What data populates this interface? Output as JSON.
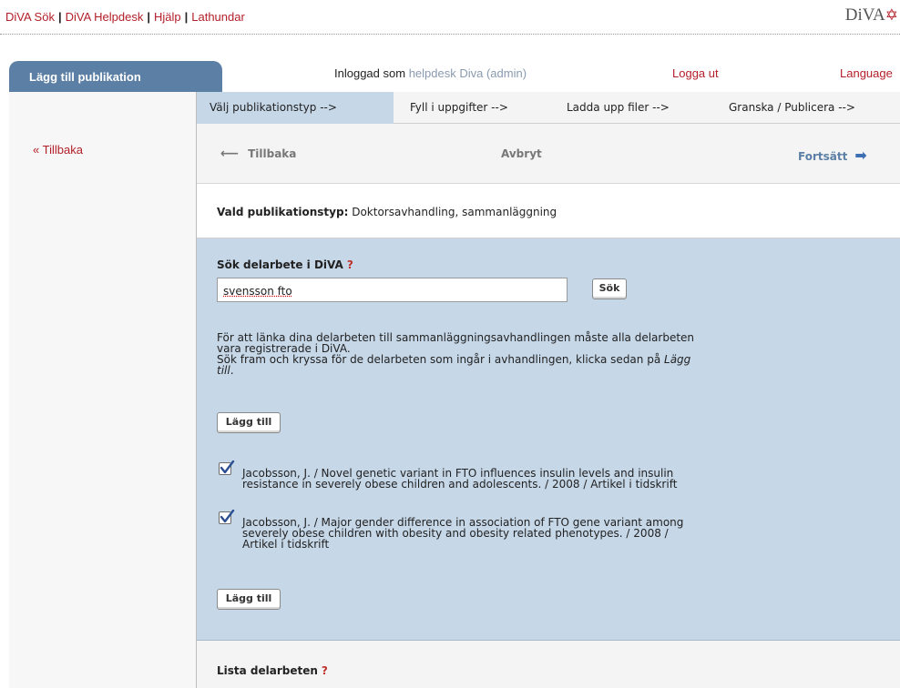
{
  "top_links": [
    "DiVA Sök",
    "DiVA Helpdesk",
    "Hjälp",
    "Lathundar"
  ],
  "logo": "DiVA",
  "tab_title": "Lägg till publikation",
  "user_prefix": "Inloggad som",
  "user_name": "helpdesk Diva (admin)",
  "logout": "Logga ut",
  "language": "Language",
  "back_link": "« Tillbaka",
  "steps": [
    "Välj publikationstyp -->",
    "Fyll i uppgifter -->",
    "Ladda upp filer -->",
    "Granska / Publicera -->"
  ],
  "nav": {
    "back": "Tillbaka",
    "cancel": "Avbryt",
    "next": "Fortsätt"
  },
  "pub_type": {
    "label": "Vald publikationstyp:",
    "value": "Doktorsavhandling, sammanläggning"
  },
  "search": {
    "title": "Sök delarbete i DiVA",
    "help": "?",
    "value": "svensson fto",
    "button": "Sök"
  },
  "info": {
    "line1": "För att länka dina delarbeten till sammanläggningsavhandlingen måste alla delarbeten",
    "line2": "vara registrerade i DiVA.",
    "line3": "Sök fram och kryssa för de delarbeten som ingår i avhandlingen, klicka sedan på",
    "line3_em": "Lägg",
    "line4_em": "till",
    "line4_tail": "."
  },
  "add_button": "Lägg till",
  "results": [
    {
      "checked": true,
      "line1": "Jacobsson, J. / Novel genetic variant in FTO influences insulin levels and insulin",
      "line2": "resistance in severely obese children and adolescents. / 2008 / Artikel i tidskrift",
      "line3": ""
    },
    {
      "checked": true,
      "line1": "Jacobsson, J. / Major gender difference in association of FTO gene variant among",
      "line2": "severely obese children with obesity and obesity related phenotypes. / 2008 /",
      "line3": "Artikel i tidskrift"
    }
  ],
  "list_title": "Lista delarbeten",
  "list_help": "?",
  "colors": {
    "brand_red": "#b3202a",
    "tab_blue": "#5b7fa5",
    "panel_blue": "#c6d7e8",
    "arrow_blue": "#3d6fb4"
  }
}
